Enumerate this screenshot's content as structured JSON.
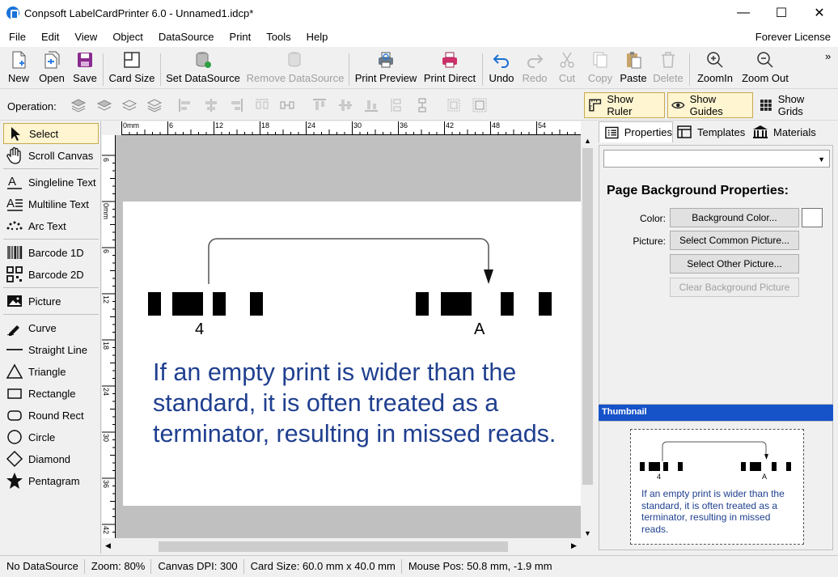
{
  "window": {
    "title": "Conpsoft LabelCardPrinter 6.0 - Unnamed1.idcp*",
    "minimize": "—",
    "maximize": "☐",
    "close": "✕"
  },
  "menu": {
    "items": [
      "File",
      "Edit",
      "View",
      "Object",
      "DataSource",
      "Print",
      "Tools",
      "Help"
    ],
    "license": "Forever License"
  },
  "toolbar": {
    "new": "New",
    "open": "Open",
    "save": "Save",
    "card_size": "Card Size",
    "set_datasource": "Set DataSource",
    "remove_datasource": "Remove DataSource",
    "print_preview": "Print Preview",
    "print_direct": "Print Direct",
    "undo": "Undo",
    "redo": "Redo",
    "cut": "Cut",
    "copy": "Copy",
    "paste": "Paste",
    "delete": "Delete",
    "zoom_in": "ZoomIn",
    "zoom_out": "Zoom Out",
    "more": "»"
  },
  "operation": {
    "label": "Operation:",
    "show_ruler": "Show Ruler",
    "show_guides": "Show Guides",
    "show_grids": "Show Grids"
  },
  "tools": {
    "select": "Select",
    "scroll_canvas": "Scroll Canvas",
    "singleline_text": "Singleline Text",
    "multiline_text": "Multiline Text",
    "arc_text": "Arc Text",
    "barcode_1d": "Barcode 1D",
    "barcode_2d": "Barcode 2D",
    "picture": "Picture",
    "curve": "Curve",
    "straight_line": "Straight Line",
    "triangle": "Triangle",
    "rectangle": "Rectangle",
    "round_rect": "Round Rect",
    "circle": "Circle",
    "diamond": "Diamond",
    "pentagram": "Pentagram"
  },
  "ruler": {
    "h_labels": [
      "0mm",
      "6",
      "12",
      "18",
      "24",
      "30",
      "36",
      "42",
      "48",
      "54"
    ],
    "v_labels": [
      "6",
      "0mm",
      "6",
      "12",
      "18",
      "24",
      "30",
      "36",
      "42"
    ]
  },
  "card": {
    "label_left": "4",
    "label_right": "A",
    "text": "If an empty print is wider than the standard, it is often treated as a terminator, resulting in missed reads."
  },
  "right_panel": {
    "tabs": [
      "Properties",
      "Templates",
      "Materials"
    ],
    "title": "Page Background Properties:",
    "color_label": "Color:",
    "color_button": "Background Color...",
    "picture_label": "Picture:",
    "common_picture": "Select Common Picture...",
    "other_picture": "Select Other Picture...",
    "clear_picture": "Clear Background Picture",
    "thumbnail_header": "Thumbnail",
    "thumb_label_left": "4",
    "thumb_label_right": "A",
    "thumb_text": "If an empty print is wider than the standard, it is often treated as a terminator, resulting in missed reads."
  },
  "status": {
    "datasource": "No DataSource",
    "zoom": "Zoom: 80%",
    "dpi": "Canvas DPI: 300",
    "card_size": "Card Size: 60.0 mm x 40.0 mm",
    "mouse_pos": "Mouse Pos: 50.8 mm, -1.9 mm"
  },
  "colors": {
    "accent": "#1653c8",
    "text_blue": "#1f3f8f",
    "selected_bg": "#fff5d1"
  }
}
